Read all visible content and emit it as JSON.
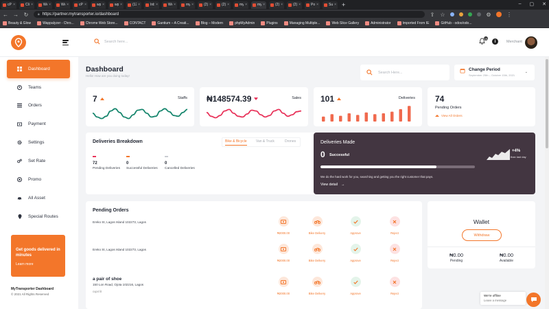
{
  "browser": {
    "tabs": [
      "cPan",
      "Cliq",
      "Web",
      "Web",
      "cPan",
      "wp-a",
      "wp-a",
      "(12)",
      "Inbo",
      "Web",
      "my_t",
      "(2) S",
      "(2) S",
      "myti",
      "myti",
      "(2) S",
      "(2) S",
      "Pony",
      "Sub"
    ],
    "active_tab": 14,
    "url": "https://partner.mytransporter.io/dashboard",
    "bookmarks": [
      "Beauty & Glow",
      "Wappalyzer - Chro...",
      "Chrome Web Store...",
      "CONTACT",
      "Gantium – A Creati...",
      "Blog – Modern",
      "phpMyAdmin",
      "Plugins",
      "Managing Multiple...",
      "Web Slice Gallery",
      "Administrator",
      "Imported From IE",
      "GitHub - odoo/odo..."
    ]
  },
  "header": {
    "search_placeholder": "Search here...",
    "notification_count": "19",
    "role": "Merchant"
  },
  "sidebar": {
    "items": [
      {
        "label": "Dashboard",
        "icon": "grid-icon"
      },
      {
        "label": "Teams",
        "icon": "user-circle-icon"
      },
      {
        "label": "Orders",
        "icon": "list-icon"
      },
      {
        "label": "Payment",
        "icon": "money-icon"
      },
      {
        "label": "Settings",
        "icon": "gear-icon"
      },
      {
        "label": "Set Rate",
        "icon": "cogs-icon"
      },
      {
        "label": "Promo",
        "icon": "target-icon"
      },
      {
        "label": "All Asset",
        "icon": "car-icon"
      },
      {
        "label": "Special Routes",
        "icon": "pin-icon"
      }
    ],
    "promo": {
      "title": "Get goods delivered in minutes",
      "link": "Learn more"
    },
    "footer_title": "MyTransporter Dashboard",
    "footer_copy": "© 2021 All Rights Reserved"
  },
  "page": {
    "title": "Dashboard",
    "subtitle": "Hello! How are you doing today!",
    "search_placeholder": "Search Here...",
    "period_label": "Change Period",
    "period_range": "September 25th – October 15th, 2021"
  },
  "stats": {
    "staffs": {
      "value": "7",
      "label": "Staffs"
    },
    "sales": {
      "value": "₦148574.39",
      "label": "Sales"
    },
    "deliveries": {
      "value": "101",
      "label": "Deliveries"
    },
    "pending": {
      "value": "74",
      "label": "Pending Orders",
      "link": "View All Orders"
    }
  },
  "breakdown": {
    "title": "Deliveries Breakdown",
    "tabs": [
      "Bike & Bicycle",
      "Van & Truck",
      "Drones"
    ],
    "active_tab": 0,
    "items": [
      {
        "value": "72",
        "label": "Pending Deliveries",
        "color": "#e8335a"
      },
      {
        "value": "0",
        "label": "Successful Deliveries",
        "color": "#f3762a"
      },
      {
        "value": "0",
        "label": "Cancelled Deliveries",
        "color": "#c9ccd1"
      }
    ]
  },
  "deliveries_made": {
    "title": "Deliveries Made",
    "value": "0",
    "label": "Successful",
    "progress": 0.75,
    "description": "We do the hard work for you, searching and getting you the right customer that pays.",
    "link": "View detail",
    "change": "+4%",
    "change_label": "than last day"
  },
  "pending_orders": {
    "title": "Pending Orders",
    "actions": [
      "Approve",
      "Reject"
    ],
    "orders": [
      {
        "name": "",
        "address": "Ereko St, Lagos Island 102273, Lagos",
        "extra": "",
        "price": "₦2000.00",
        "mode": "Bike Delivery"
      },
      {
        "name": "",
        "address": "Ereko St, Lagos Island 102273, Lagos",
        "extra": "",
        "price": "₦2000.00",
        "mode": "Bike Delivery"
      },
      {
        "name": "a pair of shoe",
        "address": "150 Lon Road, Ojota 102216, Lagos",
        "extra": "cup4 lit",
        "price": "₦2000.00",
        "mode": "Bike Delivery"
      }
    ]
  },
  "wallet": {
    "title": "Wallet",
    "button": "Withdraw",
    "pending": {
      "amount": "₦0.00",
      "label": "Pending"
    },
    "available": {
      "amount": "₦0.00",
      "label": "Available"
    }
  },
  "chat": {
    "title": "We're offline",
    "subtitle": "Leave a message"
  },
  "colors": {
    "accent": "#f3762a",
    "dark_card": "#433641",
    "staffs_line": "#16866d",
    "sales_line": "#e8335a"
  },
  "sparks": {
    "staffs": [
      0.55,
      0.3,
      0.2,
      0.35,
      0.7,
      0.85,
      0.6,
      0.3,
      0.2,
      0.45,
      0.75,
      0.8,
      0.55,
      0.3,
      0.35,
      0.7,
      0.85,
      0.65,
      0.4,
      0.35,
      0.6,
      0.8
    ],
    "sales": [
      0.6,
      0.35,
      0.25,
      0.4,
      0.7,
      0.8,
      0.55,
      0.35,
      0.3,
      0.5,
      0.75,
      0.7,
      0.45,
      0.3,
      0.4,
      0.7,
      0.8,
      0.55,
      0.35,
      0.45,
      0.65,
      0.7
    ],
    "deliveries": [
      0.3,
      0.45,
      0.35,
      0.5,
      0.4,
      0.55,
      0.45,
      0.5,
      0.6,
      0.75,
      0.95
    ]
  }
}
